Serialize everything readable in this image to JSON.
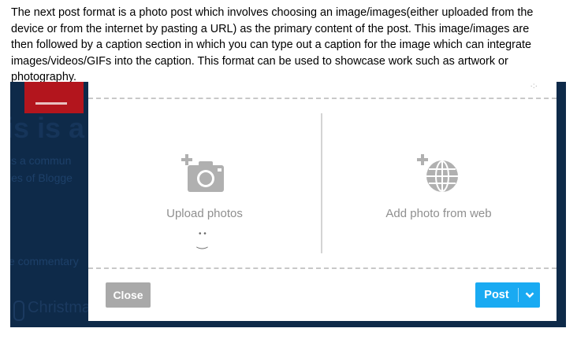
{
  "caption": {
    "line1": "The next post format is a photo post which involves choosing an image/images(either uploaded from the",
    "line2": "device or from the internet by pasting a URL) as the primary content of the post. This image/images are",
    "line3": "then followed by a caption section in which you can type out a caption for the image which can integrate",
    "line4": "images/videos/GIFs into the caption. This format can be used to showcase work such as artwork or",
    "line5": "photography."
  },
  "background": {
    "title_fragment": "is is a",
    "line_a": "is a commun",
    "line_b": "ies of Blogge",
    "line_c": "e commentary",
    "line_d": "Christma"
  },
  "modal": {
    "upload": {
      "label": "Upload photos",
      "icon": "camera-plus-icon"
    },
    "web": {
      "label": "Add photo from web",
      "icon": "globe-plus-icon"
    },
    "close_label": "Close",
    "post_label": "Post"
  },
  "colors": {
    "accent": "#19aaf2",
    "close_button": "#a9a9a9",
    "background_panel": "#0e2a49",
    "thumbnail": "#b3151d",
    "icon_gray": "#b0b0b0"
  }
}
